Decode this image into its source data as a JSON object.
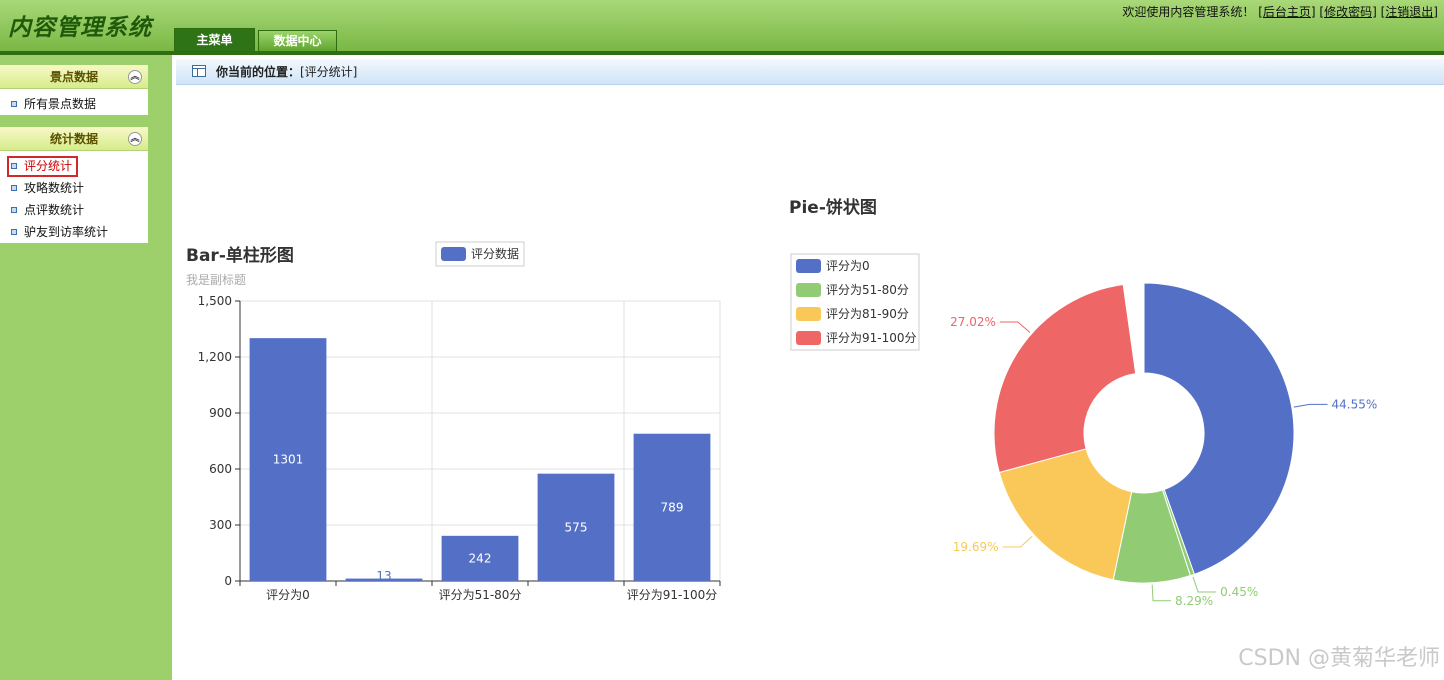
{
  "header": {
    "logo": "内容管理系统",
    "tabs": [
      {
        "label": "主菜单"
      },
      {
        "label": "数据中心"
      }
    ],
    "welcome": "欢迎使用内容管理系统！",
    "links": [
      "[后台主页]",
      "[修改密码]",
      "[注销退出]"
    ]
  },
  "sidebar": {
    "panels": [
      {
        "title": "景点数据",
        "items": [
          "所有景点数据"
        ]
      },
      {
        "title": "统计数据",
        "items": [
          "评分统计",
          "攻略数统计",
          "点评数统计",
          "驴友到访率统计"
        ]
      }
    ],
    "active_item": "评分统计"
  },
  "breadcrumb": {
    "label": "你当前的位置：",
    "value": "[评分统计]"
  },
  "chart_data": [
    {
      "type": "bar",
      "title": "Bar-单柱形图",
      "subtitle": "我是副标题",
      "legend": [
        "评分数据"
      ],
      "categories": [
        "评分为0",
        "",
        "评分为51-80分",
        "",
        "评分为91-100分"
      ],
      "series": [
        {
          "name": "评分数据",
          "values": [
            1301,
            13,
            242,
            575,
            789
          ]
        }
      ],
      "ylim": [
        0,
        1500
      ],
      "yticks": [
        "0",
        "300",
        "600",
        "900",
        "1,200",
        "1,500"
      ],
      "color": "#5470c6"
    },
    {
      "type": "pie",
      "title": "Pie-饼状图",
      "legend": [
        "评分为0",
        "评分为51-80分",
        "评分为81-90分",
        "评分为91-100分"
      ],
      "slices": [
        {
          "name": "评分为0",
          "value": 44.55,
          "label": "44.55%",
          "color": "#5470c6"
        },
        {
          "name": "",
          "value": 0.45,
          "label": "0.45%",
          "color": "#91cc75"
        },
        {
          "name": "评分为51-80分",
          "value": 8.29,
          "label": "8.29%",
          "color": "#91cc75"
        },
        {
          "name": "评分为81-90分",
          "value": 19.69,
          "label": "19.69%",
          "color": "#fac858"
        },
        {
          "name": "评分为91-100分",
          "value": 27.02,
          "label": "27.02%",
          "color": "#ee6666"
        }
      ]
    }
  ],
  "watermark": "CSDN @黄菊华老师"
}
